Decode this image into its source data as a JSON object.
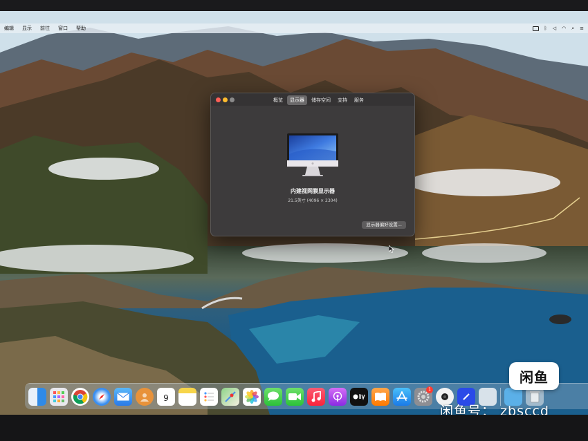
{
  "menubar": {
    "items": [
      "编辑",
      "显示",
      "前往",
      "窗口",
      "帮助"
    ],
    "tray": [
      "battery-icon",
      "bluetooth-icon",
      "volume-icon",
      "wifi-icon",
      "search-icon",
      "control-center-icon"
    ]
  },
  "window": {
    "tabs": [
      {
        "label": "概览",
        "active": false
      },
      {
        "label": "显示器",
        "active": true
      },
      {
        "label": "储存空间",
        "active": false
      },
      {
        "label": "支持",
        "active": false
      },
      {
        "label": "服务",
        "active": false
      }
    ],
    "display_name": "内建视网膜显示器",
    "display_size": "21.5英寸 (4096 × 2304)",
    "prefs_button": "显示器偏好设置..."
  },
  "dock": {
    "calendar": {
      "day": "9"
    },
    "appstore_badge": "1"
  },
  "watermark": {
    "logo": "闲鱼",
    "text": "闲鱼号： zbsccd"
  },
  "colors": {
    "window_bg": "#3d3b3c",
    "close": "#ff5f57",
    "minimize": "#febc2e"
  }
}
